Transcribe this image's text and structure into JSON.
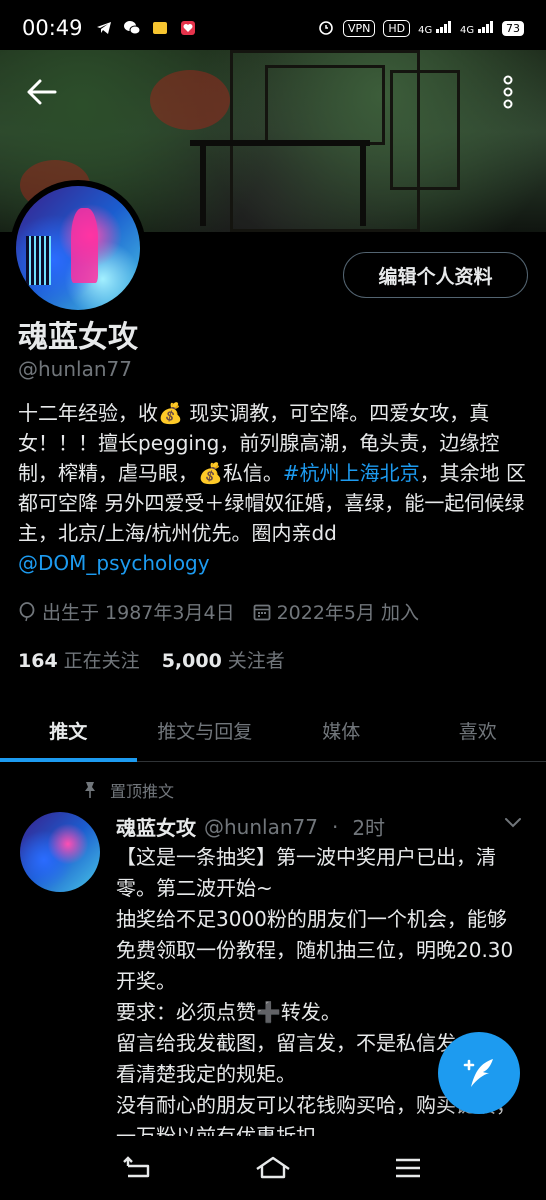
{
  "status_bar": {
    "time": "00:49",
    "vpn": "VPN",
    "hd": "HD",
    "net1": "4G",
    "net2": "4G",
    "battery": "73"
  },
  "profile": {
    "edit_button": "编辑个人资料",
    "name": "魂蓝女攻",
    "handle": "@hunlan77",
    "bio": {
      "part1": "十二年经验，收💰 现实调教，可空降。四爱女攻，真女！！！擅长pegging，前列腺高潮，龟头责，边缘控制，榨精，虐马眼，💰私信。",
      "hashtag": "#杭州上海北京",
      "part2": "，其余地 区都可空降 另外四爱受＋绿帽奴征婚，喜绿，能一起伺候绿主，北京/上海/杭州优先。圈内亲dd ",
      "mention": "@DOM_psychology"
    },
    "birth": "出生于 1987年3月4日",
    "joined": "2022年5月 加入",
    "following_count": "164",
    "following_label": "正在关注",
    "followers_count": "5,000",
    "followers_label": "关注者"
  },
  "tabs": [
    "推文",
    "推文与回复",
    "媒体",
    "喜欢"
  ],
  "pinned_label": "置顶推文",
  "tweet": {
    "name": "魂蓝女攻",
    "handle": "@hunlan77",
    "separator": "·",
    "time": "2时",
    "text": "【这是一条抽奖】第一波中奖用户已出，清零。第二波开始~\n抽奖给不足3000粉的朋友们一个机会，能够免费领取一份教程，随机抽三位，明晚20.30开奖。\n要求：必须点赞➕转发。\n留言给我发截图，留言发，不是私信发\n看清楚我定的规矩。\n没有耐心的朋友可以花钱购买哈，购买链接，一万粉以前有优惠折扣"
  },
  "colors": {
    "accent": "#1d9bf0",
    "text_primary": "#e7e9ea",
    "text_secondary": "#71767b",
    "background": "#000000"
  },
  "icons": {
    "back": "arrow-left-icon",
    "more": "more-vertical-icon",
    "birth": "balloon-icon",
    "calendar": "calendar-icon",
    "pin": "pin-icon",
    "compose": "compose-quill-icon"
  }
}
